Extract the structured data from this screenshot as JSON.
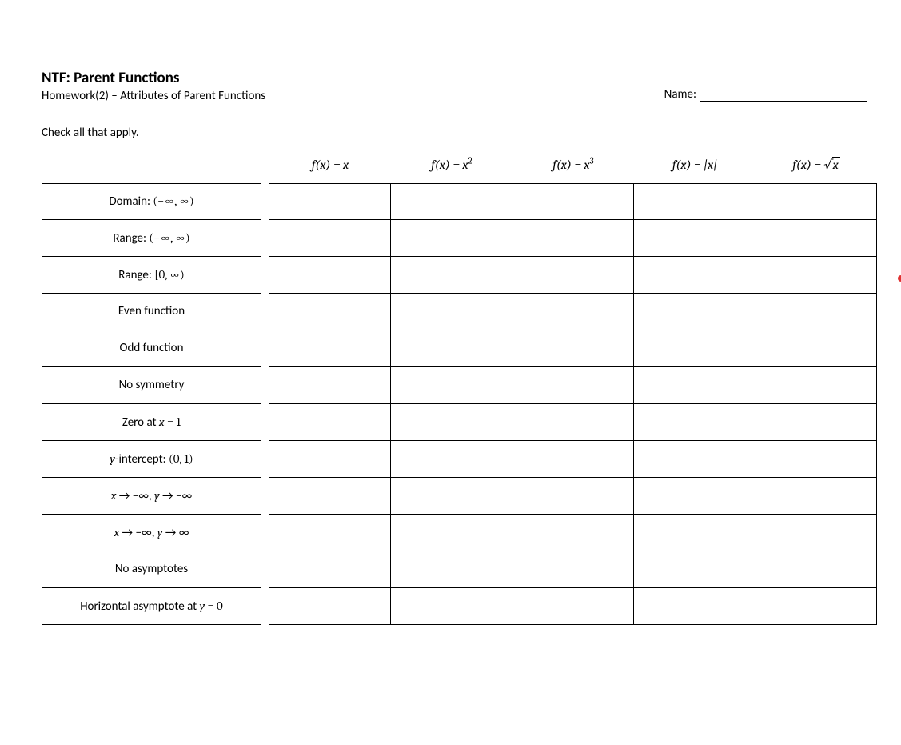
{
  "header": {
    "title": "NTF: Parent Functions",
    "subtitle": "Homework(2) – Attributes of Parent Functions",
    "name_label": "Name:"
  },
  "instruction": "Check all that apply.",
  "columns": [
    {
      "fn": "f(x) = x",
      "html": "<span class='mi'>f</span>(<span class='mi'>x</span>) = <span class='mi'>x</span>"
    },
    {
      "fn": "f(x) = x^2",
      "html": "<span class='mi'>f</span>(<span class='mi'>x</span>) = <span class='mi'>x</span><sup><span class='mn'>2</span></sup>"
    },
    {
      "fn": "f(x) = x^3",
      "html": "<span class='mi'>f</span>(<span class='mi'>x</span>) = <span class='mi'>x</span><sup><span class='mn'>3</span></sup>"
    },
    {
      "fn": "f(x) = |x|",
      "html": "<span class='mi'>f</span>(<span class='mi'>x</span>) = |<span class='mi'>x</span>|"
    },
    {
      "fn": "f(x) = sqrt(x)",
      "html": "<span class='mi'>f</span>(<span class='mi'>x</span>) = <span class='sqrt'>√<span class='rad mi'>x</span></span>"
    }
  ],
  "rows": [
    {
      "label": "Domain: (−∞, ∞)",
      "html": "Domain: <span class='mn'>(−∞, ∞)</span>"
    },
    {
      "label": "Range: (−∞, ∞)",
      "html": "Range: <span class='mn'>(−∞, ∞)</span>"
    },
    {
      "label": "Range: [0, ∞)",
      "html": "Range: <span class='mn'>[0, ∞)</span>"
    },
    {
      "label": "Even function",
      "html": "Even function"
    },
    {
      "label": "Odd function",
      "html": "Odd function"
    },
    {
      "label": "No symmetry",
      "html": "No symmetry"
    },
    {
      "label": "Zero at x = 1",
      "html": "Zero at <span class='mi'>x</span> <span class='mn'>= 1</span>"
    },
    {
      "label": "y-intercept: (0, 1)",
      "html": "<span class='mi'>y</span>-intercept: <span class='mn'>(0, 1)</span>"
    },
    {
      "label": "x → −∞, y → −∞",
      "html": "<span class='mi'>x</span> → −∞, <span class='mi'>y</span> → −∞"
    },
    {
      "label": "x → −∞, y → ∞",
      "html": "<span class='mi'>x</span> → −∞, <span class='mi'>y</span> → ∞"
    },
    {
      "label": "No asymptotes",
      "html": "No asymptotes"
    },
    {
      "label": "Horizontal asymptote at y = 0",
      "html": "Horizontal asymptote at <span class='mi'>y</span> <span class='mn'>= 0</span>"
    }
  ]
}
